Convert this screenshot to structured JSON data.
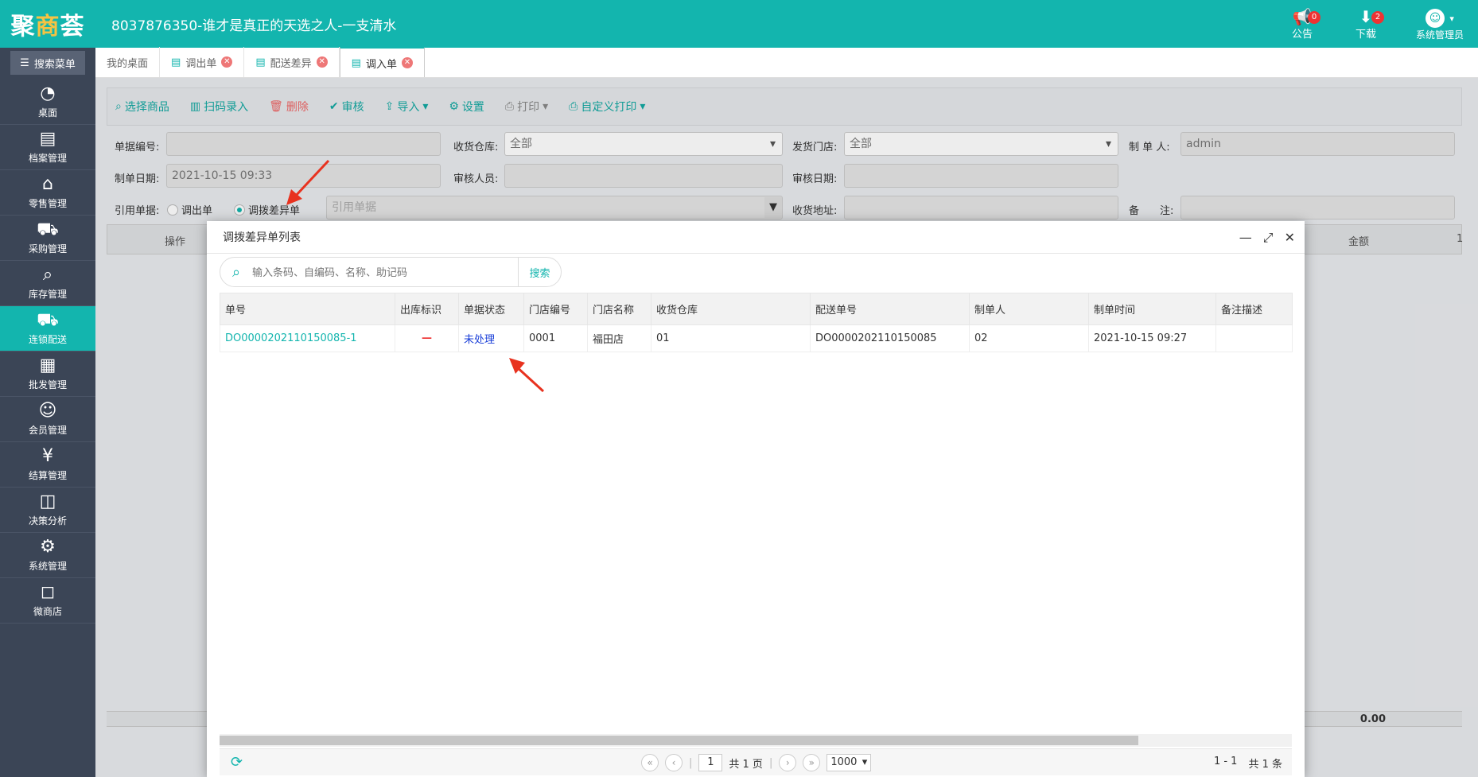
{
  "topbar": {
    "logo_main": "聚",
    "logo_accent": "商",
    "logo_rest": "荟",
    "title": "8037876350-谁才是真正的天选之人-一支清水",
    "announcement_label": "公告",
    "announcement_count": "0",
    "download_label": "下载",
    "download_count": "2",
    "user_label": "系统管理员"
  },
  "sidebar": {
    "search_label": "搜索菜单",
    "items": [
      {
        "label": "桌面"
      },
      {
        "label": "档案管理"
      },
      {
        "label": "零售管理"
      },
      {
        "label": "采购管理"
      },
      {
        "label": "库存管理"
      },
      {
        "label": "连锁配送"
      },
      {
        "label": "批发管理"
      },
      {
        "label": "会员管理"
      },
      {
        "label": "结算管理"
      },
      {
        "label": "决策分析"
      },
      {
        "label": "系统管理"
      },
      {
        "label": "微商店"
      }
    ]
  },
  "tabs": [
    {
      "label": "我的桌面"
    },
    {
      "label": "调出单"
    },
    {
      "label": "配送差异"
    },
    {
      "label": "调入单"
    }
  ],
  "toolbar": {
    "select_goods": "选择商品",
    "scan_entry": "扫码录入",
    "delete": "删除",
    "audit": "审核",
    "import": "导入",
    "settings": "设置",
    "print": "打印",
    "custom_print": "自定义打印"
  },
  "form": {
    "doc_no_label": "单据编号:",
    "recv_wh_label": "收货仓库:",
    "recv_wh_value": "全部",
    "ship_store_label": "发货门店:",
    "ship_store_value": "全部",
    "maker_label": "制 单 人:",
    "maker_value": "admin",
    "date_label": "制单日期:",
    "date_value": "2021-10-15 09:33",
    "auditor_label": "审核人员:",
    "audit_date_label": "审核日期:",
    "ref_label": "引用单据:",
    "radio_out": "调出单",
    "radio_diff": "调拨差异单",
    "ref_placeholder": "引用单据",
    "addr_label": "收货地址:",
    "remark_label": "备　　注:"
  },
  "grid": {
    "col_op": "操作",
    "col_amount": "金额",
    "col_extra": "1",
    "total": "0.00"
  },
  "modal": {
    "title": "调拨差异单列表",
    "search_placeholder": "输入条码、自编码、名称、助记码",
    "search_button": "搜索",
    "columns": [
      "单号",
      "出库标识",
      "单据状态",
      "门店编号",
      "门店名称",
      "收货仓库",
      "配送单号",
      "制单人",
      "制单时间",
      "备注描述"
    ],
    "rows": [
      {
        "doc_no": "DO0000202110150085-1",
        "out_flag": "—",
        "status": "未处理",
        "store_no": "0001",
        "store_name": "福田店",
        "warehouse": "01",
        "delivery_no": "DO0000202110150085",
        "maker": "02",
        "made_time": "2021-10-15 09:27",
        "remark": ""
      }
    ],
    "pager": {
      "page_input": "1",
      "total_pages": "共 1 页",
      "page_size": "1000",
      "range": "1 - 1",
      "total": "共 1 条"
    }
  },
  "colors": {
    "brand": "#13b5ae",
    "sidebar": "#3b4556",
    "status_link": "#1a3fd8",
    "arrow": "#e8321f"
  }
}
